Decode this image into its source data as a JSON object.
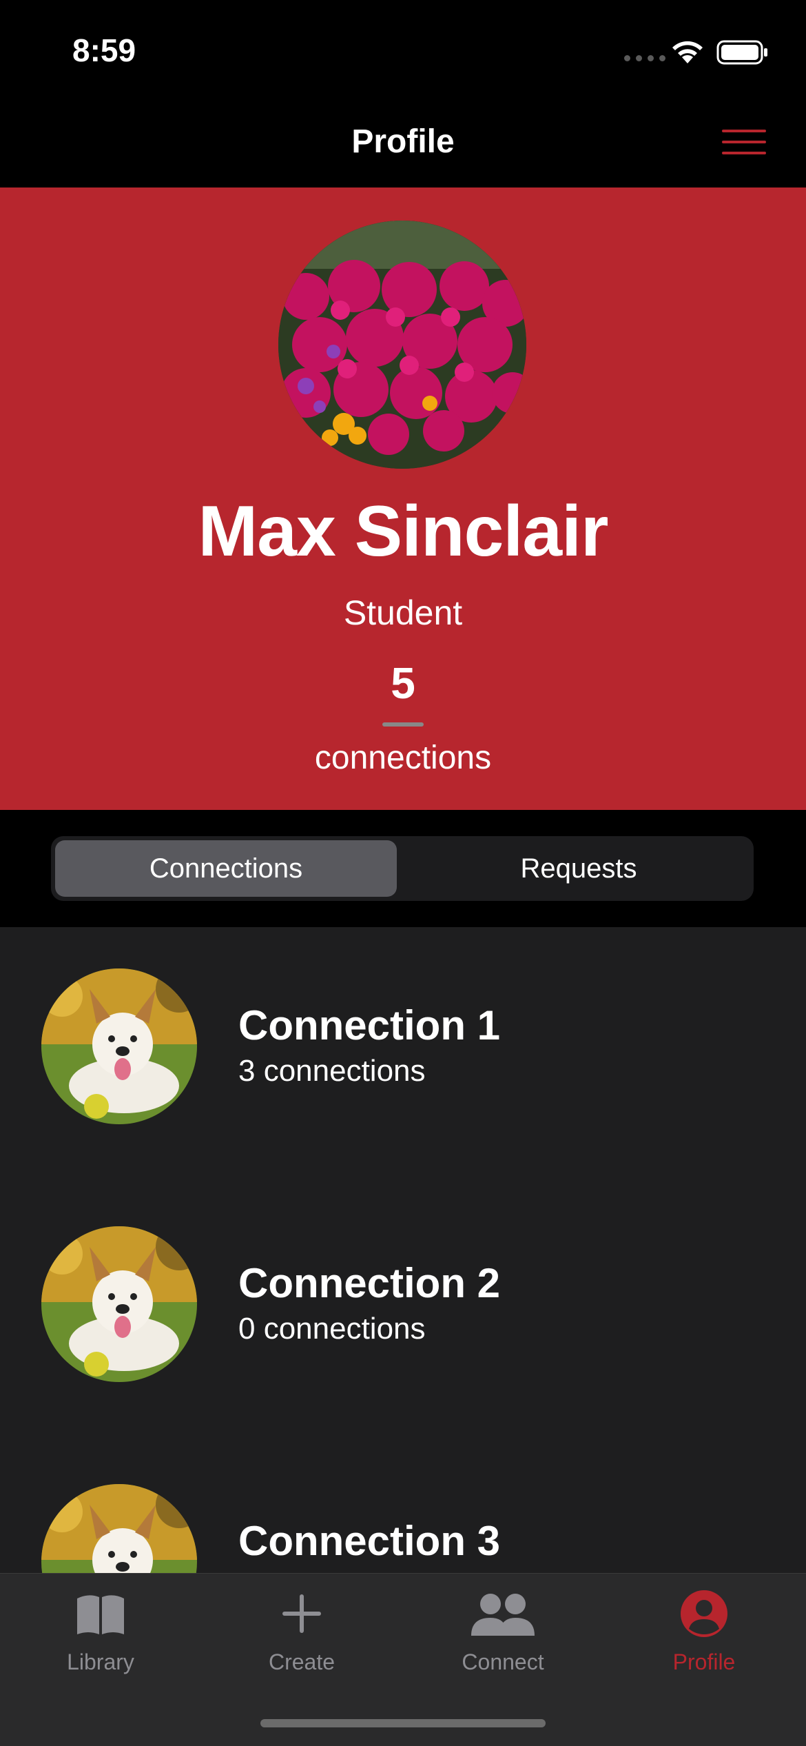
{
  "status_bar": {
    "time": "8:59"
  },
  "nav": {
    "title": "Profile",
    "menu_icon": "hamburger-menu-icon"
  },
  "profile": {
    "name": "Max Sinclair",
    "role": "Student",
    "connection_count": "5",
    "connection_label": "connections",
    "avatar": "flower-field-photo"
  },
  "segmented": {
    "selected": "Connections",
    "options": [
      "Connections",
      "Requests"
    ]
  },
  "connections": [
    {
      "name": "Connection 1",
      "subtitle": "3 connections",
      "avatar": "dog-photo"
    },
    {
      "name": "Connection 2",
      "subtitle": "0 connections",
      "avatar": "dog-photo"
    },
    {
      "name": "Connection 3",
      "subtitle": "",
      "avatar": "dog-photo"
    }
  ],
  "tabs": [
    {
      "label": "Library",
      "icon": "book-icon"
    },
    {
      "label": "Create",
      "icon": "plus-icon"
    },
    {
      "label": "Connect",
      "icon": "people-icon"
    },
    {
      "label": "Profile",
      "icon": "person-circle-icon",
      "active": true
    }
  ],
  "colors": {
    "accent": "#b7262e",
    "header_bg": "#b7262e",
    "background": "#1e1e1f",
    "inactive_tab": "#8e8e93"
  }
}
